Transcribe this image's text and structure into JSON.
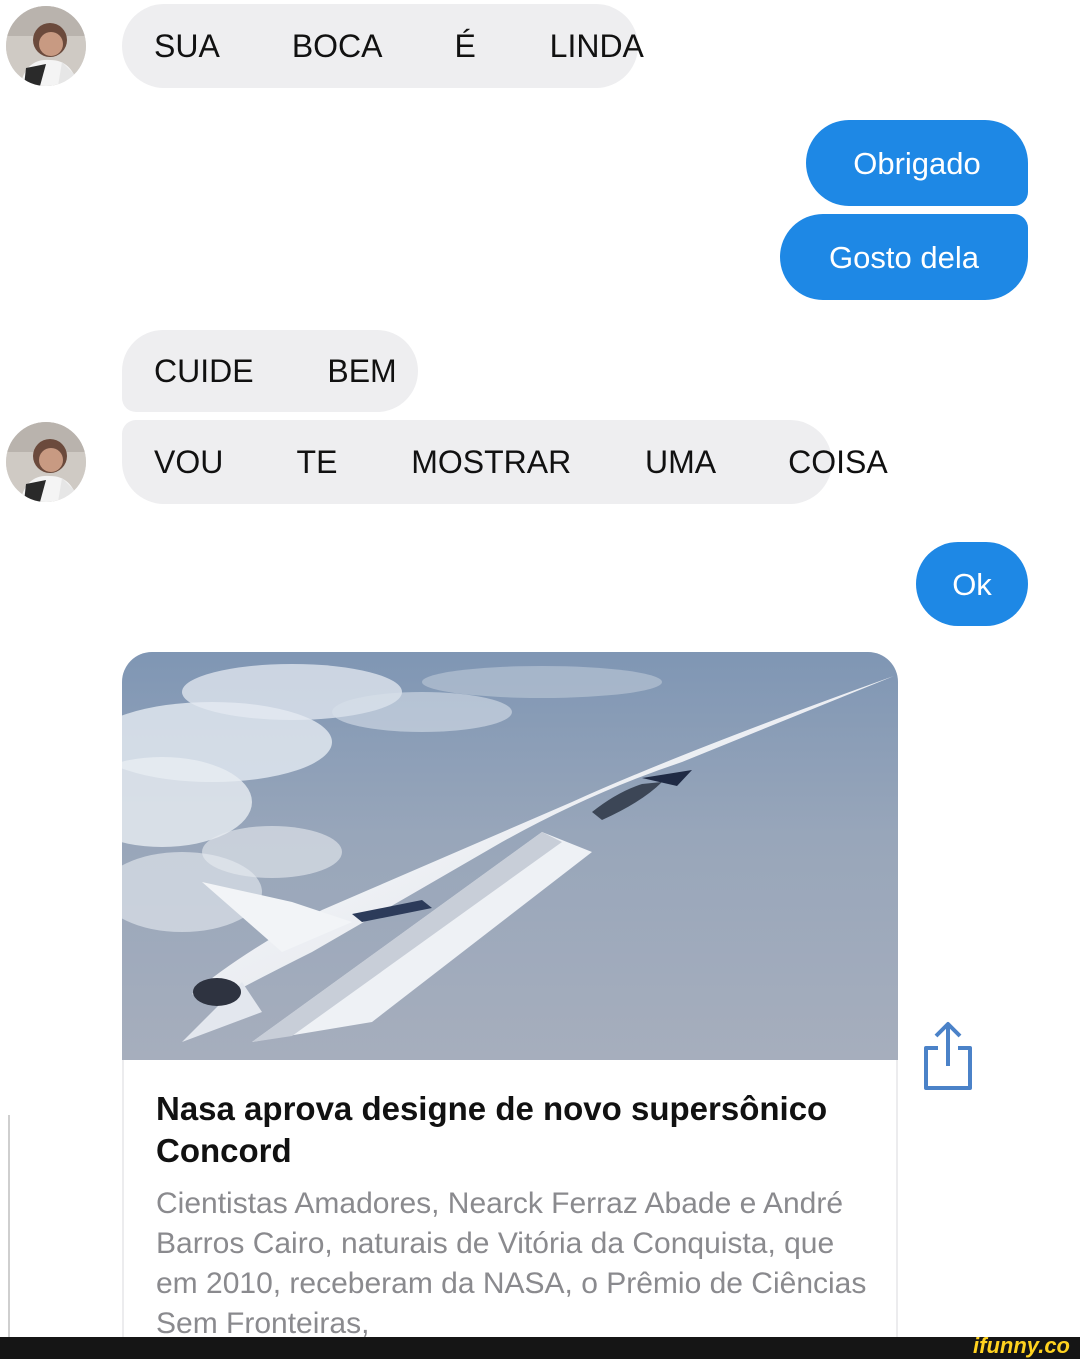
{
  "conversation": {
    "messages": [
      {
        "side": "incoming",
        "text": "SUA  BOCA  É  LINDA"
      },
      {
        "side": "outgoing",
        "text": "Obrigado"
      },
      {
        "side": "outgoing",
        "text": "Gosto dela"
      },
      {
        "side": "incoming",
        "text": "CUIDE  BEM"
      },
      {
        "side": "incoming",
        "text": "VOU  TE  MOSTRAR  UMA  COISA"
      },
      {
        "side": "outgoing",
        "text": "Ok"
      }
    ]
  },
  "link_card": {
    "title": "Nasa aprova designe de novo supersônico Concord",
    "description": "Cientistas Amadores, Nearck Ferraz Abade e André Barros Cairo, naturais de Vitória da Conquista, que em 2010, receberam da NASA, o Prêmio de Ciências Sem Fronteiras,",
    "image": "supersonic-jet-over-clouds",
    "share_icon": "share-icon"
  },
  "watermark": {
    "text": "ifunny.co"
  },
  "colors": {
    "incoming_bubble": "#eeeef0",
    "outgoing_bubble": "#1e88e5",
    "incoming_text": "#111111",
    "outgoing_text": "#ffffff",
    "watermark": "#ffd21f"
  }
}
